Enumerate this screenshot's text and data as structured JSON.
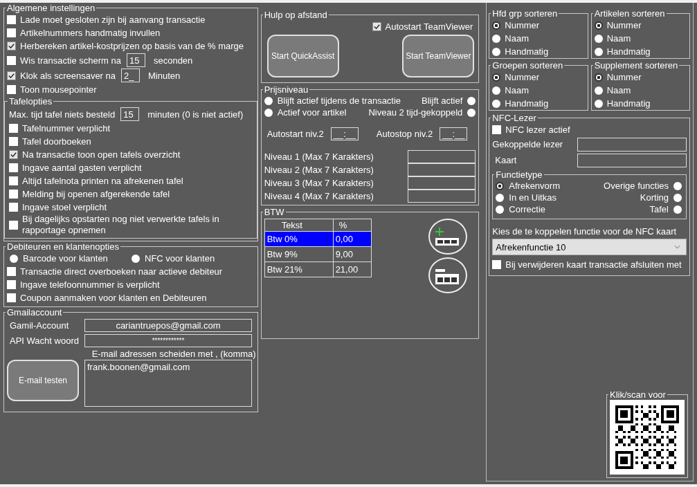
{
  "general": {
    "title": "Algemene instellingen",
    "options": [
      {
        "kind": "check",
        "label": "Lade moet gesloten zijn bij aanvang transactie",
        "checked": false
      },
      {
        "kind": "check",
        "label": "Artikelnummers handmatig invullen",
        "checked": false
      },
      {
        "kind": "check",
        "label": "Herbereken artikel-kostprijzen  op basis van de % marge",
        "checked": true
      },
      {
        "kind": "check_field",
        "label": "Wis transactie scherm na",
        "checked": false,
        "value": "15",
        "unit": "seconden"
      },
      {
        "kind": "check_field",
        "label": "Klok als screensaver na",
        "checked": true,
        "value": "2_",
        "unit": "Minuten"
      },
      {
        "kind": "check",
        "label": "Toon mousepointer",
        "checked": false
      }
    ]
  },
  "tables": {
    "title": "Tafelopties",
    "options": [
      {
        "kind": "field",
        "label": "Max. tijd tafel niets besteld",
        "value": "15",
        "unit": "minuten (0 is niet actief)"
      },
      {
        "kind": "check",
        "label": "Tafelnummer verplicht",
        "checked": false
      },
      {
        "kind": "check",
        "label": "Tafel  doorboeken",
        "checked": false
      },
      {
        "kind": "check",
        "label": "Na transactie toon open tafels overzicht",
        "checked": true
      },
      {
        "kind": "check",
        "label": "Ingave aantal gasten verplicht",
        "checked": false
      },
      {
        "kind": "check",
        "label": "Altijd tafelnota printen na afrekenen tafel",
        "checked": false
      },
      {
        "kind": "check",
        "label": "Melding bij openen afgerekende tafel",
        "checked": false
      },
      {
        "kind": "check",
        "label": "Ingave stoel verplicht",
        "checked": false
      },
      {
        "kind": "check",
        "label": "Bij dagelijks opstarten nog niet verwerkte tafels in rapportage opnemen",
        "checked": false
      }
    ]
  },
  "debtors": {
    "title": "Debiteuren en klantenopties",
    "radios": [
      {
        "label": "Barcode voor klanten",
        "selected": false
      },
      {
        "label": "NFC voor klanten",
        "selected": false
      }
    ],
    "options": [
      {
        "label": "Transactie direct  overboeken naar actieve debiteur",
        "checked": false
      },
      {
        "label": "Ingave telefoonnummer is verplicht",
        "checked": false
      },
      {
        "label": "Coupon aanmaken voor klanten en Debiteuren",
        "checked": false
      }
    ]
  },
  "gmail": {
    "title": "Gmailaccount",
    "account_label": "Gamil-Account",
    "account": "cariantruepos@gmail.com",
    "password_label": "API Wacht woord",
    "password": "************",
    "note": "E-mail adressen scheiden met , (komma)",
    "test_button": "E-mail testen",
    "recipients": "frank.boonen@gmail.com"
  },
  "remote": {
    "title": "Hulp op afstand",
    "autostart": {
      "label": "Autostart TeamViewer",
      "checked": true
    },
    "buttons": [
      "Start QuickAssist",
      "Start TeamViewer"
    ]
  },
  "price_level": {
    "title": "Prijsniveau",
    "radios": [
      {
        "label": "Blijft actief tijdens de transactie",
        "kind": "left",
        "selected": false
      },
      {
        "label": "Blijft actief",
        "kind": "right",
        "selected": false
      },
      {
        "label": "Actief voor artikel",
        "kind": "left",
        "selected": false
      },
      {
        "label": "Niveau 2 tijd-gekoppeld",
        "kind": "right",
        "selected": false
      }
    ],
    "autostart_label": "Autostart niv.2",
    "autostart": "__:__",
    "autostop_label": "Autostop niv.2",
    "autostop": "__:__",
    "levels": [
      "Niveau 1 (Max 7 Karakters)",
      "Niveau 2 (Max 7 Karakters)",
      "Niveau 3 (Max 7 Karakters)",
      "Niveau 4 (Max 7 Karakters)"
    ]
  },
  "vat": {
    "title": "BTW",
    "columns": [
      "Tekst",
      "%"
    ],
    "rows": [
      {
        "text": "Btw  0%",
        "percent": "0,00",
        "selected": true
      },
      {
        "text": "Btw   9%",
        "percent": "9,00",
        "selected": false
      },
      {
        "text": "Btw 21%",
        "percent": "21,00",
        "selected": false
      }
    ]
  },
  "sorting": [
    {
      "title": "Hfd grp sorteren",
      "options": [
        {
          "label": "Nummer",
          "selected": true
        },
        {
          "label": "Naam",
          "selected": false
        },
        {
          "label": "Handmatig",
          "selected": false
        }
      ]
    },
    {
      "title": "Artikelen sorteren",
      "options": [
        {
          "label": "Nummer",
          "selected": true
        },
        {
          "label": "Naam",
          "selected": false
        },
        {
          "label": "Handmatig",
          "selected": false
        }
      ]
    },
    {
      "title": "Groepen sorteren",
      "options": [
        {
          "label": "Nummer",
          "selected": true
        },
        {
          "label": "Naam",
          "selected": false
        },
        {
          "label": "Handmatig",
          "selected": false
        }
      ]
    },
    {
      "title": "Supplement sorteren",
      "options": [
        {
          "label": "Nummer",
          "selected": true
        },
        {
          "label": "Naam",
          "selected": false
        },
        {
          "label": "Handmatig",
          "selected": false
        }
      ]
    }
  ],
  "nfc": {
    "title": "NFC-Lezer",
    "active": {
      "label": "NFC lezer actief",
      "checked": false
    },
    "reader_label": "Gekoppelde lezer",
    "card_label": "Kaart",
    "function_type": {
      "title": "Functietype",
      "options": [
        {
          "label": "Afrekenvorm",
          "kind": "left",
          "selected": true
        },
        {
          "label": "Overige  functies",
          "kind": "right",
          "selected": false
        },
        {
          "label": "In en Uitkas",
          "kind": "left",
          "selected": false
        },
        {
          "label": "Korting",
          "kind": "right",
          "selected": false
        },
        {
          "label": "Correctie",
          "kind": "left",
          "selected": false
        },
        {
          "label": "Tafel",
          "kind": "right",
          "selected": false
        }
      ]
    },
    "prompt": "Kies de te koppelen functie voor de NFC kaart",
    "function": "Afrekenfunctie 10",
    "close_on_remove": {
      "label": "Bij verwijderen kaart transactie afsluiten met",
      "checked": false
    }
  },
  "qr": {
    "title": "Klik/scan voor"
  }
}
